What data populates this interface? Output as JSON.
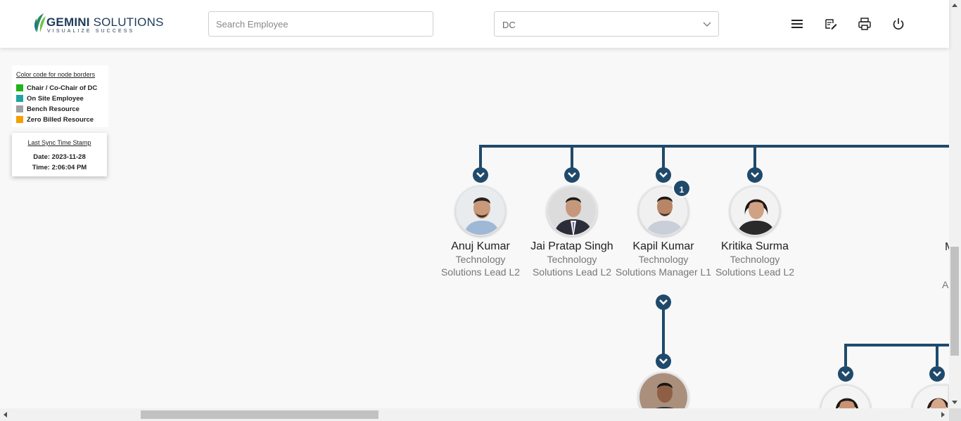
{
  "header": {
    "logo_main_bold": "GEMINI",
    "logo_main_rest": " SOLUTIONS",
    "logo_tagline": "VISUALIZE SUCCESS",
    "search_placeholder": "Search Employee",
    "dc_select_value": "DC",
    "icons": [
      "menu-icon",
      "edit-note-icon",
      "print-icon",
      "power-icon"
    ],
    "brand_color": "#1f3b5a"
  },
  "legend": {
    "title": "Color code for node borders",
    "items": [
      {
        "label": "Chair / Co-Chair of DC",
        "color": "#22b21a"
      },
      {
        "label": "On Site Employee",
        "color": "#1fa3a3"
      },
      {
        "label": "Bench Resource",
        "color": "#a0a0a0"
      },
      {
        "label": "Zero Billed Resource",
        "color": "#f5a000"
      }
    ]
  },
  "sync": {
    "title": "Last Sync Time Stamp",
    "date": "Date: 2023-11-28",
    "time": "Time: 2:06:04 PM"
  },
  "tree": {
    "connector_color": "#1f4a6b",
    "nodes": [
      {
        "name": "Anuj Kumar",
        "dept": "Technology",
        "role": "Solutions Lead L2"
      },
      {
        "name": "Jai Pratap Singh",
        "dept": "Technology",
        "role": "Solutions Lead L2"
      },
      {
        "name": "Kapil Kumar",
        "dept": "Technology",
        "role": "Solutions Manager L1",
        "badge": "1"
      },
      {
        "name": "Kritika Surma",
        "dept": "Technology",
        "role": "Solutions Lead L2"
      }
    ],
    "partial_name": "M",
    "partial_dept": "A"
  }
}
